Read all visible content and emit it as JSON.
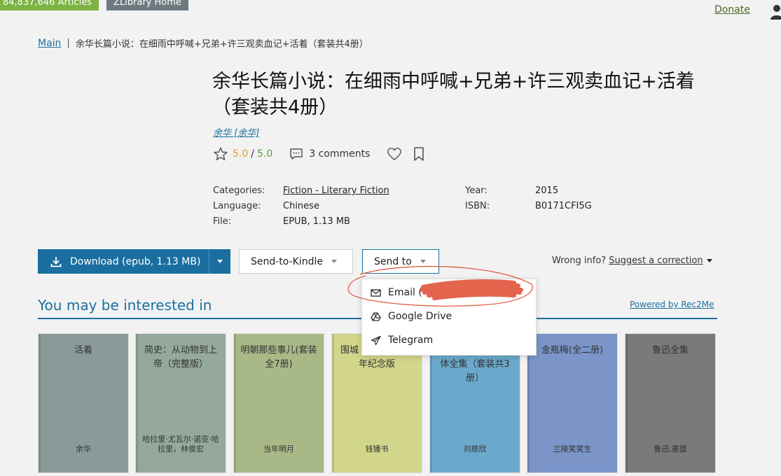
{
  "topbar": {
    "articles_label": "84,837,646 Articles",
    "zlibrary_home_label": "ZLibrary Home",
    "donate_label": "Donate"
  },
  "breadcrumb": {
    "main_label": "Main",
    "separator": "|",
    "current": "余华长篇小说：在细雨中呼喊+兄弟+许三观卖血记+活着（套装共4册）"
  },
  "book": {
    "title": "余华长篇小说：在细雨中呼喊+兄弟+许三观卖血记+活着（套装共4册）",
    "author": "余华 [余华]",
    "rating_quality": "5.0",
    "rating_sep": "/",
    "rating_popularity": "5.0",
    "comments_label": "3 comments"
  },
  "props": {
    "left": [
      {
        "label": "Categories:",
        "value": "Fiction - Literary Fiction"
      },
      {
        "label": "Language:",
        "value": "Chinese"
      },
      {
        "label": "File:",
        "value": "EPUB, 1.13 MB"
      }
    ],
    "right": [
      {
        "label": "Year:",
        "value": "2015"
      },
      {
        "label": "ISBN:",
        "value": "B0171CFI5G"
      }
    ]
  },
  "actions": {
    "download_label": "Download (epub, 1.13 MB)",
    "send_to_kindle_label": "Send-to-Kindle",
    "send_to_label": "Send to",
    "wrong_info_label": "Wrong info?",
    "suggest_label": "Suggest a correction"
  },
  "send_to_menu": {
    "items": [
      {
        "label": "Email (",
        "icon": "mail-icon"
      },
      {
        "label": "Google Drive",
        "icon": "google-drive-icon"
      },
      {
        "label": "Telegram",
        "icon": "telegram-icon"
      }
    ]
  },
  "interested": {
    "title": "You may be interested in",
    "powered_label": "Powered by Rec2Me",
    "books": [
      {
        "title": "活着",
        "author": "余华",
        "color": "#8a9a98"
      },
      {
        "title": "简史：从动物到上帝（完整版）",
        "author": "哈拉里·尤瓦尔·诺亚·哈拉里，林俊宏",
        "color": "#94a89c"
      },
      {
        "title": "明朝那些事儿(套装全7册)",
        "author": "当年明月",
        "color": "#a8b887"
      },
      {
        "title": "围城",
        "author": "钱锺书",
        "color": "#d2d68a"
      },
      {
        "title": "体全集（套装共3册）",
        "author": "刘慈欣",
        "color": "#6ba9cc"
      },
      {
        "title": "金瓶梅(全二册)",
        "author": "兰陵笑笑生",
        "color": "#7b95c8"
      },
      {
        "title": "鲁迅全集",
        "author": "鲁迅,墨盟",
        "color": "#7a7a7a"
      }
    ],
    "partial_book_text": "年纪念版"
  }
}
